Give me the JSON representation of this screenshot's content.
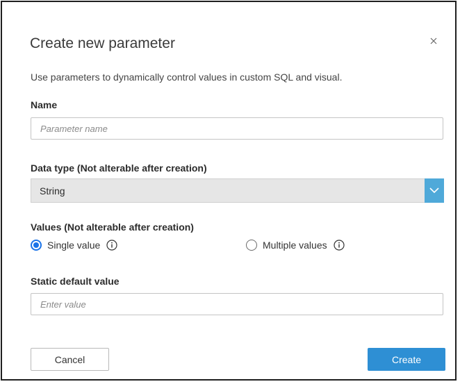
{
  "dialog": {
    "title": "Create new parameter",
    "description": "Use parameters to dynamically control values in custom SQL and visual.",
    "close_icon": "close-icon"
  },
  "name_field": {
    "label": "Name",
    "placeholder": "Parameter name",
    "value": ""
  },
  "data_type": {
    "label": "Data type (Not alterable after creation)",
    "selected": "String",
    "icon": "chevron-down-icon"
  },
  "values": {
    "label": "Values (Not alterable after creation)",
    "options": [
      {
        "label": "Single value",
        "checked": true,
        "icon": "info-icon"
      },
      {
        "label": "Multiple values",
        "checked": false,
        "icon": "info-icon"
      }
    ]
  },
  "default_value": {
    "label": "Static default value",
    "placeholder": "Enter value",
    "value": ""
  },
  "buttons": {
    "cancel": "Cancel",
    "create": "Create"
  },
  "colors": {
    "accent": "#2e8fd4",
    "dropdown_arrow_bg": "#4fa9d9",
    "radio_checked": "#1a73e8"
  }
}
